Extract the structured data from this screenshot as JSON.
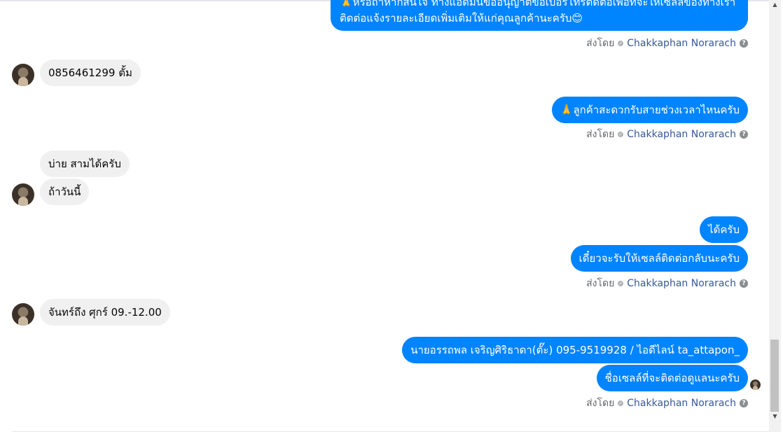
{
  "messages": {
    "m1_line1": "🙏หรือถ้าหากสนใจ ทางแอดมินขออนุญาตขอเบอร์โทรติดต่อเพื่อที่จะให้เซลล์ของทางเรา",
    "m1_line2": "ติดต่อแจ้งรายละเอียดเพิ่มเติมให้แก่คุณลูกค้านะครับ😊",
    "m2": "0856461299  ตั้ม",
    "m3": "🙏ลูกค้าสะดวกรับสายช่วงเวลาไหนครับ",
    "m4": "บ่าย สามได้ครับ",
    "m5": "ถ้าวันนี้",
    "m6": "ได้ครับ",
    "m7": "เดี๋ยวจะรับให้เซลล์ติดต่อกลับนะครับ",
    "m8": "จันทร์ถึง ศุกร์  09.-12.00",
    "m9": "นายอรรถพล เจริญศิริธาดา(ตั๊ะ)       095-9519928 / ไอดีไลน์ ta_attapon_",
    "m10": "ชื่อเซลล์ที่จะติดต่อดูแลนะครับ"
  },
  "sent_by": {
    "prefix": "ส่งโดย",
    "name": "Chakkaphan Norarach",
    "help": "?"
  },
  "icons": {
    "check": "✓",
    "scroll_up": "▲",
    "scroll_down": "▼"
  }
}
